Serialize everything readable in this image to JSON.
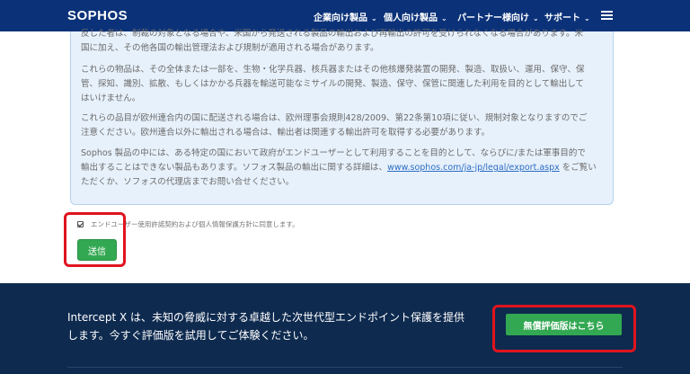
{
  "nav": {
    "logo": "SOPHOS",
    "items": [
      {
        "label": "企業向け製品"
      },
      {
        "label": "個人向け製品"
      },
      {
        "label": "パートナー様向け"
      },
      {
        "label": "サポート"
      }
    ]
  },
  "notice": {
    "paragraph1": [
      "反した者は、制裁の対象となる場合や、米国から発送される製品の輸出および再輸出の許可を受けられなくなる場合があります。米",
      "国に加え、その他各国の輸出管理法および規制が適用される場合があります。"
    ],
    "paragraph2": [
      "これらの物品は、その全体または一部を、生物・化学兵器、核兵器またはその他核爆発装置の開発、製造、取扱い、運用、保守、保",
      "管、探知、識別、拡散、もしくはかかる兵器を輸送可能なミサイルの開発、製造、保守、保管に関連した利用を目的として輸出して",
      "はいけません。"
    ],
    "paragraph3": [
      "これらの品目が欧州連合内の国に配送される場合は、欧州理事会規則428/2009、第22条第10項に従い、規制対象となりますのでご",
      "注意ください。欧州連合以外に輸出される場合は、輸出者は関連する輸出許可を取得する必要があります。"
    ],
    "paragraph4": {
      "line1": "Sophos 製品の中には、ある特定の国において政府がエンドユーザーとして利用することを目的として、ならびに/または軍事目的で",
      "line2_before": "輸出することはできない製品もあります。ソフォス製品の輸出に関する詳細は、",
      "link": "www.sophos.com/ja-jp/legal/export.aspx",
      "line2_after": " をご覧い",
      "line3": "ただくか、ソフォスの代理店までお問い合せください。"
    }
  },
  "form": {
    "consent_label": "エンドユーザー使用許諾契約および個人情報保護方針に同意します。",
    "consent_checked": true,
    "submit_label": "送信"
  },
  "footer": {
    "line1": "Intercept X は、未知の脅威に対する卓越した次世代型エンドポイント保護を提供",
    "line2": "します。今すぐ評価版を試用してご体験ください。",
    "trial_button": "無償評価版はこちら"
  },
  "colors": {
    "nav_bg": "#0b3279",
    "footer_bg": "#0e2a4f",
    "button_green": "#33a852",
    "highlight_red": "#e0141e",
    "panel_bg": "#e7f1fb",
    "link": "#2b6cc4"
  }
}
